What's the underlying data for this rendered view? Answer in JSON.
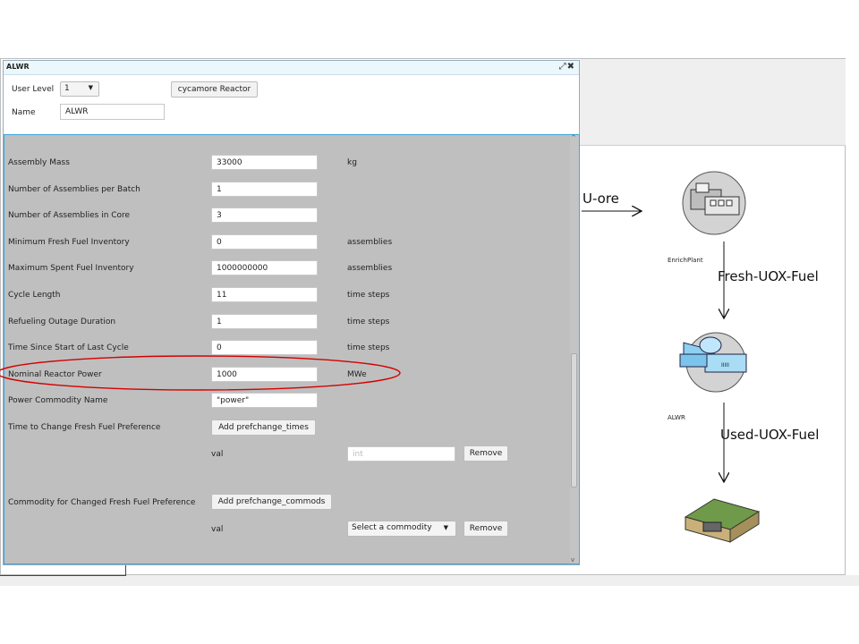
{
  "flow": {
    "u_ore": "U-ore",
    "fresh_uox": "Fresh-UOX-Fuel",
    "used_uox": "Used-UOX-Fuel",
    "enrich_plant": "EnrichPlant",
    "alwr_node": "ALWR"
  },
  "dialog": {
    "title": "ALWR",
    "user_level_label": "User Level",
    "user_level_value": "1",
    "archetype_button": "cycamore Reactor",
    "name_label": "Name",
    "name_value": "ALWR"
  },
  "params": [
    {
      "label": "Assembly Mass",
      "value": "33000",
      "unit": "kg"
    },
    {
      "label": "Number of Assemblies per Batch",
      "value": "1",
      "unit": ""
    },
    {
      "label": "Number of Assemblies in Core",
      "value": "3",
      "unit": ""
    },
    {
      "label": "Minimum Fresh Fuel Inventory",
      "value": "0",
      "unit": "assemblies"
    },
    {
      "label": "Maximum Spent Fuel Inventory",
      "value": "1000000000",
      "unit": "assemblies"
    },
    {
      "label": "Cycle Length",
      "value": "11",
      "unit": "time steps"
    },
    {
      "label": "Refueling Outage Duration",
      "value": "1",
      "unit": "time steps"
    },
    {
      "label": "Time Since Start of Last Cycle",
      "value": "0",
      "unit": "time steps"
    },
    {
      "label": "Nominal Reactor Power",
      "value": "1000",
      "unit": "MWe"
    },
    {
      "label": "Power Commodity Name",
      "value": "\"power\"",
      "unit": ""
    }
  ],
  "prefchange": {
    "times_label": "Time to Change Fresh Fuel Preference",
    "times_button": "Add prefchange_times",
    "times_val_label": "val",
    "times_placeholder": "int",
    "times_remove": "Remove",
    "commods_label": "Commodity for Changed Fresh Fuel Preference",
    "commods_button": "Add prefchange_commods",
    "commods_val_label": "val",
    "commods_select": "Select a commodity",
    "commods_remove": "Remove"
  },
  "colors": {
    "highlight_ellipse": "#d40000",
    "panel_border": "#3fa7d9",
    "panel_bg": "#bfbfbf"
  }
}
